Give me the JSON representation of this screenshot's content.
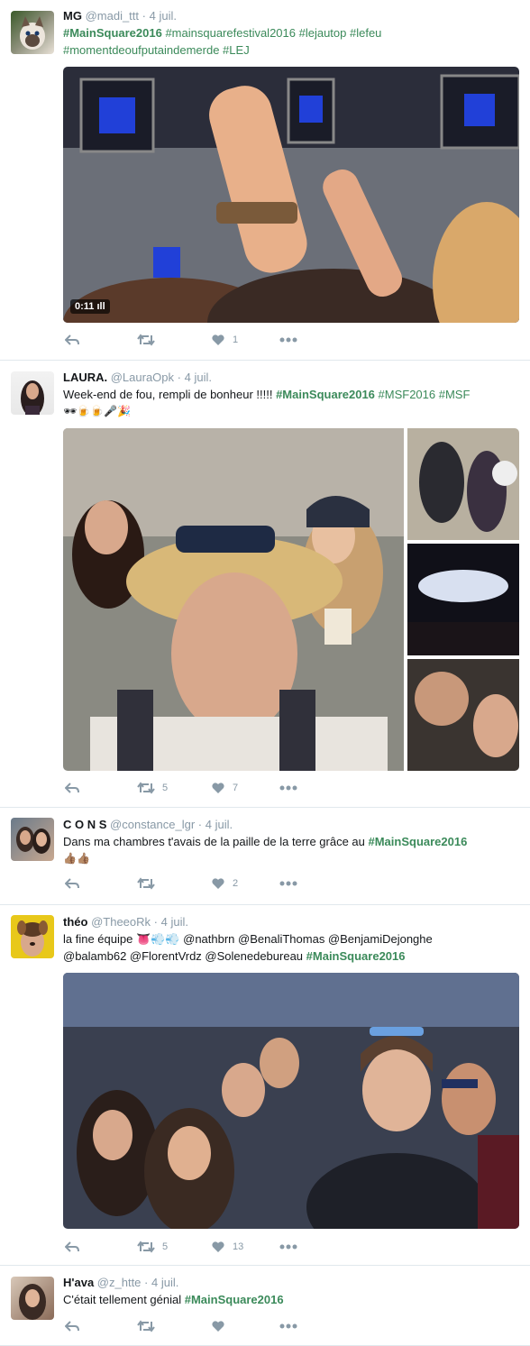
{
  "tweets": [
    {
      "name": "MG",
      "handle": "@madi_ttt",
      "date": "4 juil.",
      "text_parts": [
        {
          "t": "#MainSquare2016",
          "k": "hashtag"
        },
        {
          "t": " #mainsquarefestival2016 #lejautop #lefeu",
          "k": "hashtag plain"
        },
        {
          "t": "#momentdeoufputaindemerde #LEJ",
          "k": "hashtag plain"
        }
      ],
      "video_duration": "0:11",
      "reply_count": "",
      "retweet_count": "",
      "like_count": "1"
    },
    {
      "name": "LAURA.",
      "handle": "@LauraOpk",
      "date": "4 juil.",
      "text_line1_prefix": "Week-end de fou, rempli de bonheur !!!!! ",
      "text_line1_tag": "#MainSquare2016",
      "text_line1_suffix": " #MSF2016 #MSF",
      "emoji_line": "🕶🍺🍺🎤🎉",
      "retweet_count": "5",
      "like_count": "7"
    },
    {
      "name": "C O N S",
      "handle": "@constance_lgr",
      "date": "4 juil.",
      "text_prefix": "Dans ma chambres t'avais de la paille de la terre grâce au ",
      "text_tag": "#MainSquare2016",
      "emoji_line": "👍🏽👍🏽",
      "retweet_count": "",
      "like_count": "2"
    },
    {
      "name": "théo",
      "handle": "@TheeoRk",
      "date": "4 juil.",
      "text_line1": "la fine équipe 👅💨💨 @nathbrn @BenaliThomas @BenjamiDejonghe",
      "text_line2_prefix": "@balamb62 @FlorentVrdz  @Solenedebureau ",
      "text_line2_tag": "#MainSquare2016",
      "retweet_count": "5",
      "like_count": "13"
    },
    {
      "name": "H'ava",
      "handle": "@z_htte",
      "date": "4 juil.",
      "text_prefix": "C'était tellement génial ",
      "text_tag": "#MainSquare2016",
      "retweet_count": "",
      "like_count": ""
    }
  ],
  "separator": "·",
  "colors": {
    "hashtag": "#3b8a5a",
    "meta": "#8899a6",
    "border": "#e1e8ed"
  },
  "icons": [
    "reply-icon",
    "retweet-icon",
    "heart-icon",
    "more-icon"
  ]
}
